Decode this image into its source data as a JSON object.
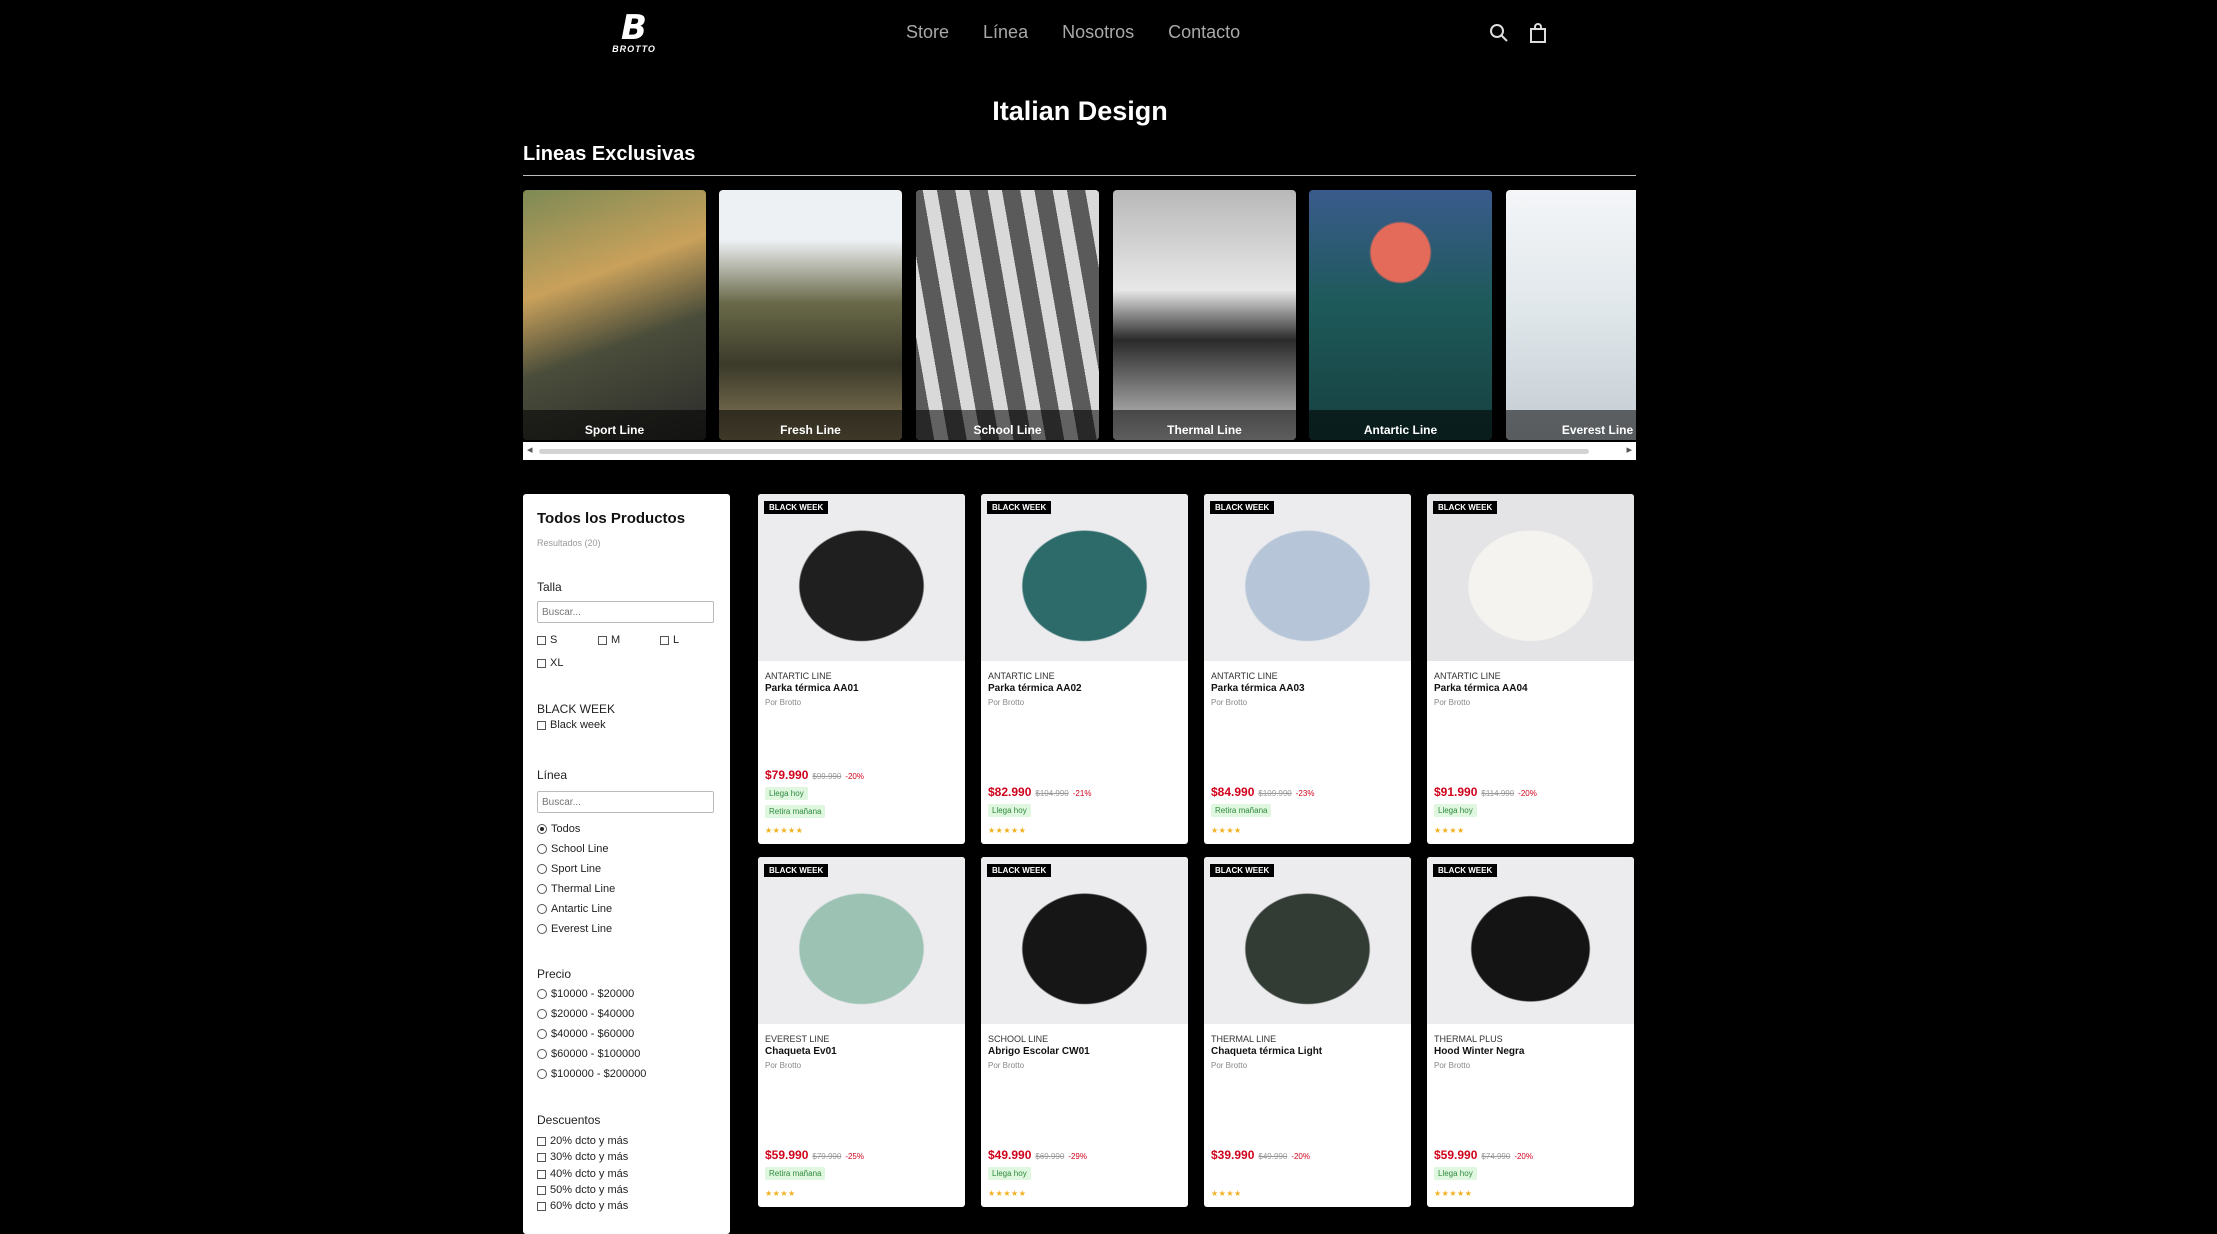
{
  "header": {
    "logo_mark": "B",
    "logo_text": "BROTTO",
    "nav": [
      "Store",
      "Línea",
      "Nosotros",
      "Contacto"
    ]
  },
  "hero": {
    "title": "Italian Design",
    "lines_title": "Lineas Exclusivas"
  },
  "lines": [
    {
      "label": "Sport Line"
    },
    {
      "label": "Fresh Line"
    },
    {
      "label": "School Line"
    },
    {
      "label": "Thermal Line"
    },
    {
      "label": "Antartic Line"
    },
    {
      "label": "Everest Line"
    }
  ],
  "filters": {
    "title": "Todos los Productos",
    "results": "Resultados (20)",
    "talla_label": "Talla",
    "talla_placeholder": "Buscar...",
    "sizes": [
      "S",
      "M",
      "L",
      "XL"
    ],
    "blackweek_label": "BLACK WEEK",
    "blackweek_option": "Black week",
    "linea_label": "Línea",
    "linea_placeholder": "Buscar...",
    "lineas": [
      "Todos",
      "School Line",
      "Sport Line",
      "Thermal Line",
      "Antartic Line",
      "Everest Line"
    ],
    "precio_label": "Precio",
    "precios": [
      "$10000 - $20000",
      "$20000 - $40000",
      "$40000 - $60000",
      "$60000 - $100000",
      "$100000 - $200000"
    ],
    "descuentos_label": "Descuentos",
    "descuentos": [
      "20% dcto y más",
      "30% dcto y más",
      "40% dcto y más",
      "50% dcto y más",
      "60% dcto y más"
    ]
  },
  "products": [
    {
      "badge": "BLACK WEEK",
      "line": "ANTARTIC LINE",
      "name": "Parka térmica AA01",
      "by": "Por Brotto",
      "price": "$79.990",
      "old": "$99.990",
      "off": "-20%",
      "tags": [
        "Llega hoy",
        "Retira mañana"
      ],
      "stars": "★★★★★"
    },
    {
      "badge": "BLACK WEEK",
      "line": "ANTARTIC LINE",
      "name": "Parka térmica AA02",
      "by": "Por Brotto",
      "price": "$82.990",
      "old": "$104.990",
      "off": "-21%",
      "tags": [
        "Llega hoy"
      ],
      "stars": "★★★★★"
    },
    {
      "badge": "BLACK WEEK",
      "line": "ANTARTIC LINE",
      "name": "Parka térmica AA03",
      "by": "Por Brotto",
      "price": "$84.990",
      "old": "$109.990",
      "off": "-23%",
      "tags": [
        "Retira mañana"
      ],
      "stars": "★★★★"
    },
    {
      "badge": "BLACK WEEK",
      "line": "ANTARTIC LINE",
      "name": "Parka térmica AA04",
      "by": "Por Brotto",
      "price": "$91.990",
      "old": "$114.990",
      "off": "-20%",
      "tags": [
        "Llega hoy"
      ],
      "stars": "★★★★"
    },
    {
      "badge": "BLACK WEEK",
      "line": "EVEREST LINE",
      "name": "Chaqueta Ev01",
      "by": "Por Brotto",
      "price": "$59.990",
      "old": "$79.990",
      "off": "-25%",
      "tags": [
        "Retira mañana"
      ],
      "stars": "★★★★"
    },
    {
      "badge": "BLACK WEEK",
      "line": "SCHOOL LINE",
      "name": "Abrigo Escolar CW01",
      "by": "Por Brotto",
      "price": "$49.990",
      "old": "$69.990",
      "off": "-29%",
      "tags": [
        "Llega hoy"
      ],
      "stars": "★★★★★"
    },
    {
      "badge": "BLACK WEEK",
      "line": "THERMAL LINE",
      "name": "Chaqueta térmica Light",
      "by": "Por Brotto",
      "price": "$39.990",
      "old": "$49.990",
      "off": "-20%",
      "tags": [],
      "stars": "★★★★"
    },
    {
      "badge": "BLACK WEEK",
      "line": "THERMAL PLUS",
      "name": "Hood Winter Negra",
      "by": "Por Brotto",
      "price": "$59.990",
      "old": "$74.990",
      "off": "-20%",
      "tags": [
        "Llega hoy"
      ],
      "stars": "★★★★★"
    }
  ]
}
